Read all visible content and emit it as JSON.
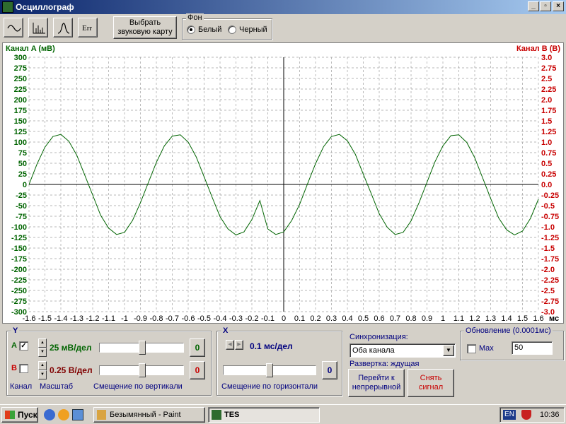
{
  "window": {
    "title": "Осциллограф"
  },
  "toolbar": {
    "buttons": [
      {
        "name": "sine-wave-icon"
      },
      {
        "name": "spectrum-icon"
      },
      {
        "name": "pulse-icon"
      },
      {
        "name": "err-icon",
        "label": "Err"
      }
    ],
    "select_card_label_1": "Выбрать",
    "select_card_label_2": "звуковую карту"
  },
  "background_group": {
    "title": "Фон",
    "options": [
      "Белый",
      "Черный"
    ],
    "selected": "Белый"
  },
  "plot": {
    "left_axis_label": "Канал A (мВ)",
    "right_axis_label": "Канал B (В)",
    "x_unit": "мс",
    "left_color": "#006400",
    "right_color": "#c80000"
  },
  "chart_data": {
    "type": "line",
    "x_ticks": [
      -1.6,
      -1.5,
      -1.4,
      -1.3,
      -1.2,
      -1.1,
      -1,
      -0.9,
      -0.8,
      -0.7,
      -0.6,
      -0.5,
      -0.4,
      -0.3,
      -0.2,
      -0.1,
      0,
      0.1,
      0.2,
      0.3,
      0.4,
      0.5,
      0.6,
      0.7,
      0.8,
      0.9,
      1,
      1.1,
      1.2,
      1.3,
      1.4,
      1.5,
      1.6
    ],
    "x_tick_labels": [
      "-1.6",
      "-1.5",
      "-1.4",
      "-1.3",
      "-1.2",
      "-1.1",
      "-1",
      "-0.9",
      "-0.8",
      "-0.7",
      "-0.6",
      "-0.5",
      "-0.4",
      "-0.3",
      "-0.2",
      "-0.1",
      "0",
      "0.1",
      "0.2",
      "0.3",
      "0.4",
      "0.5",
      "0.6",
      "0.7",
      "0.8",
      "0.9",
      "1",
      "1.1",
      "1.2",
      "1.3",
      "1.4",
      "1.5",
      "1.6"
    ],
    "xlim": [
      -1.6,
      1.6
    ],
    "left_ticks": [
      "300",
      "275",
      "250",
      "225",
      "200",
      "175",
      "150",
      "125",
      "100",
      "75",
      "50",
      "25",
      "0",
      "-25",
      "-50",
      "-75",
      "-100",
      "-125",
      "-150",
      "-175",
      "-200",
      "-225",
      "-250",
      "-275",
      "-300"
    ],
    "right_ticks": [
      "3.0",
      "2.75",
      "2.5",
      "2.25",
      "2.0",
      "1.75",
      "1.5",
      "1.25",
      "1.0",
      "0.75",
      "0.5",
      "0.25",
      "0.0",
      "-0.25",
      "-0.5",
      "-0.75",
      "-1.0",
      "-1.25",
      "-1.5",
      "-1.75",
      "-2.0",
      "-2.25",
      "-2.5",
      "-2.75",
      "-3.0"
    ],
    "ylim_left": [
      -300,
      300
    ],
    "ylim_right": [
      -3.0,
      3.0
    ],
    "grid": true,
    "series": [
      {
        "name": "Канал A",
        "color": "#006400",
        "x": [
          -1.6,
          -1.55,
          -1.5,
          -1.45,
          -1.4,
          -1.35,
          -1.3,
          -1.25,
          -1.2,
          -1.15,
          -1.1,
          -1.05,
          -1.0,
          -0.95,
          -0.9,
          -0.85,
          -0.8,
          -0.75,
          -0.7,
          -0.65,
          -0.6,
          -0.55,
          -0.5,
          -0.45,
          -0.4,
          -0.35,
          -0.3,
          -0.25,
          -0.2,
          -0.15,
          -0.1,
          -0.05,
          0.0,
          0.05,
          0.1,
          0.15,
          0.2,
          0.25,
          0.3,
          0.35,
          0.4,
          0.45,
          0.5,
          0.55,
          0.6,
          0.65,
          0.7,
          0.75,
          0.8,
          0.85,
          0.9,
          0.95,
          1.0,
          1.05,
          1.1,
          1.15,
          1.2,
          1.25,
          1.3,
          1.35,
          1.4,
          1.45,
          1.5,
          1.55,
          1.6
        ],
        "values": [
          0,
          48,
          88,
          113,
          118,
          102,
          69,
          22,
          -25,
          -73,
          -103,
          -118,
          -113,
          -85,
          -43,
          5,
          52,
          91,
          114,
          117,
          100,
          65,
          18,
          -30,
          -76,
          -105,
          -119,
          -112,
          -83,
          -38,
          -105,
          -118,
          -112,
          -85,
          -47,
          2,
          49,
          89,
          113,
          118,
          103,
          71,
          24,
          -22,
          -69,
          -101,
          -118,
          -113,
          -86,
          -43,
          5,
          53,
          91,
          115,
          117,
          99,
          63,
          15,
          -33,
          -79,
          -107,
          -119,
          -110,
          -80,
          -35
        ]
      }
    ]
  },
  "panel_y": {
    "title": "Y",
    "channel_a": "A",
    "channel_b": "B",
    "scale_a": "25 мВ/дел",
    "scale_b": "0.25 В/дел",
    "offset_a": "0",
    "offset_b": "0",
    "label_channel": "Канал",
    "label_scale": "Масштаб",
    "label_offset": "Смещение по вертикали",
    "a_checked": true,
    "b_checked": false
  },
  "panel_x": {
    "title": "X",
    "scale": "0.1 мс/дел",
    "offset": "0",
    "label_offset": "Смещение по горизонтали"
  },
  "sync": {
    "label": "Синхронизация:",
    "value": "Оба канала",
    "sweep": "Развертка: ждущая",
    "continuous_button_1": "Перейти к",
    "continuous_button_2": "непрерывной",
    "capture_button_1": "Снять",
    "capture_button_2": "сигнал"
  },
  "refresh": {
    "title": "Обновление (0.0001мс)",
    "max_label": "Max",
    "value": "50"
  },
  "taskbar": {
    "start": "Пуск",
    "items": [
      "Безымянный - Paint",
      "TES"
    ],
    "lang": "EN",
    "clock": "10:36"
  }
}
